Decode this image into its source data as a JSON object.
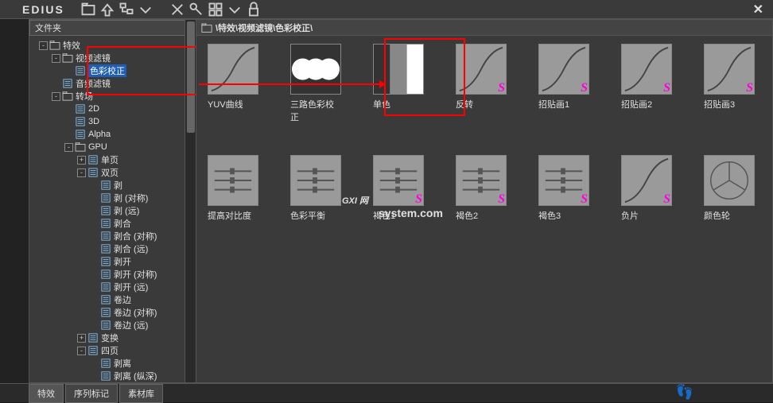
{
  "titlebar": {
    "brand": "EDIUS"
  },
  "header": {
    "folder_label": "文件夹",
    "breadcrumb": "\\特效\\视频滤镜\\色彩校正\\"
  },
  "tree": [
    {
      "depth": 0,
      "tw": "-",
      "icon": "folder",
      "label": "特效"
    },
    {
      "depth": 1,
      "tw": "-",
      "icon": "folder",
      "label": "视频滤镜"
    },
    {
      "depth": 2,
      "tw": "",
      "icon": "page",
      "label": "色彩校正",
      "sel": true
    },
    {
      "depth": 1,
      "tw": "",
      "icon": "page",
      "label": "音频滤镜"
    },
    {
      "depth": 1,
      "tw": "-",
      "icon": "folder",
      "label": "转场"
    },
    {
      "depth": 2,
      "tw": "",
      "icon": "page",
      "label": "2D"
    },
    {
      "depth": 2,
      "tw": "",
      "icon": "page",
      "label": "3D"
    },
    {
      "depth": 2,
      "tw": "",
      "icon": "page",
      "label": "Alpha"
    },
    {
      "depth": 2,
      "tw": "-",
      "icon": "folder",
      "label": "GPU"
    },
    {
      "depth": 3,
      "tw": "+",
      "icon": "page",
      "label": "单页"
    },
    {
      "depth": 3,
      "tw": "-",
      "icon": "page",
      "label": "双页"
    },
    {
      "depth": 4,
      "tw": "",
      "icon": "page",
      "label": "剥"
    },
    {
      "depth": 4,
      "tw": "",
      "icon": "page",
      "label": "剥 (对称)"
    },
    {
      "depth": 4,
      "tw": "",
      "icon": "page",
      "label": "剥 (远)"
    },
    {
      "depth": 4,
      "tw": "",
      "icon": "page",
      "label": "剥合"
    },
    {
      "depth": 4,
      "tw": "",
      "icon": "page",
      "label": "剥合 (对称)"
    },
    {
      "depth": 4,
      "tw": "",
      "icon": "page",
      "label": "剥合 (远)"
    },
    {
      "depth": 4,
      "tw": "",
      "icon": "page",
      "label": "剥开"
    },
    {
      "depth": 4,
      "tw": "",
      "icon": "page",
      "label": "剥开 (对称)"
    },
    {
      "depth": 4,
      "tw": "",
      "icon": "page",
      "label": "剥开 (远)"
    },
    {
      "depth": 4,
      "tw": "",
      "icon": "page",
      "label": "卷边"
    },
    {
      "depth": 4,
      "tw": "",
      "icon": "page",
      "label": "卷边 (对称)"
    },
    {
      "depth": 4,
      "tw": "",
      "icon": "page",
      "label": "卷边 (远)"
    },
    {
      "depth": 3,
      "tw": "+",
      "icon": "page",
      "label": "变换"
    },
    {
      "depth": 3,
      "tw": "-",
      "icon": "page",
      "label": "四页"
    },
    {
      "depth": 4,
      "tw": "",
      "icon": "page",
      "label": "剥离"
    },
    {
      "depth": 4,
      "tw": "",
      "icon": "page",
      "label": "剥离 (纵深)"
    }
  ],
  "thumbs": [
    {
      "label": "YUV曲线",
      "kind": "curve",
      "badge": false
    },
    {
      "label": "三路色彩校正",
      "kind": "threecircle",
      "badge": false
    },
    {
      "label": "单色",
      "kind": "mono",
      "badge": false,
      "highlight": true
    },
    {
      "label": "反转",
      "kind": "curve",
      "badge": true
    },
    {
      "label": "招贴画1",
      "kind": "curve",
      "badge": true
    },
    {
      "label": "招贴画2",
      "kind": "curve",
      "badge": true
    },
    {
      "label": "招贴画3",
      "kind": "curve",
      "badge": true
    },
    {
      "label": "提高对比度",
      "kind": "sliders",
      "badge": false
    },
    {
      "label": "色彩平衡",
      "kind": "sliders",
      "badge": false
    },
    {
      "label": "褐色1",
      "kind": "sliders",
      "badge": true
    },
    {
      "label": "褐色2",
      "kind": "sliders",
      "badge": true
    },
    {
      "label": "褐色3",
      "kind": "sliders",
      "badge": true
    },
    {
      "label": "负片",
      "kind": "curve",
      "badge": true
    },
    {
      "label": "颜色轮",
      "kind": "wheel",
      "badge": false
    }
  ],
  "tabs": {
    "t1": "特效",
    "t2": "序列标记",
    "t3": "素材库"
  },
  "watermark": {
    "big": "GXI 网",
    "small": "system.com"
  }
}
